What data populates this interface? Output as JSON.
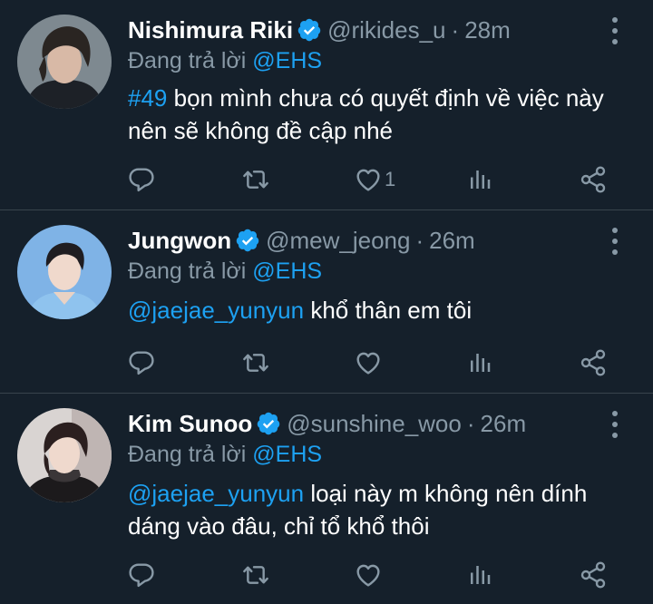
{
  "colors": {
    "background": "#15202b",
    "accent": "#1da1f2",
    "muted": "#8899a6",
    "divider": "#38444d"
  },
  "tweets": [
    {
      "name": "Nishimura Riki",
      "handle": "@rikides_u",
      "separator": "·",
      "time": "28m",
      "reply_prefix": "Đang trả lời",
      "reply_to": "@EHS",
      "content_link": "#49",
      "content_text": " bọn mình chưa có quyết định về việc này nên sẽ không đề cập nhé",
      "like_count": "1",
      "verified_icon": "verified-badge-icon"
    },
    {
      "name": "Jungwon",
      "handle": "@mew_jeong",
      "separator": "·",
      "time": "26m",
      "reply_prefix": "Đang trả lời",
      "reply_to": "@EHS",
      "content_link": "@jaejae_yunyun",
      "content_text": " khổ thân em tôi",
      "like_count": "",
      "verified_icon": "verified-badge-icon"
    },
    {
      "name": "Kim Sunoo",
      "handle": "@sunshine_woo",
      "separator": "·",
      "time": "26m",
      "reply_prefix": "Đang trả lời",
      "reply_to": "@EHS",
      "content_link": "@jaejae_yunyun",
      "content_text": " loại này m không nên dính dáng vào đâu, chỉ tổ khổ thôi",
      "like_count": "",
      "verified_icon": "verified-badge-icon"
    }
  ],
  "action_icons": [
    "reply-icon",
    "retweet-icon",
    "like-icon",
    "analytics-icon",
    "share-icon"
  ]
}
